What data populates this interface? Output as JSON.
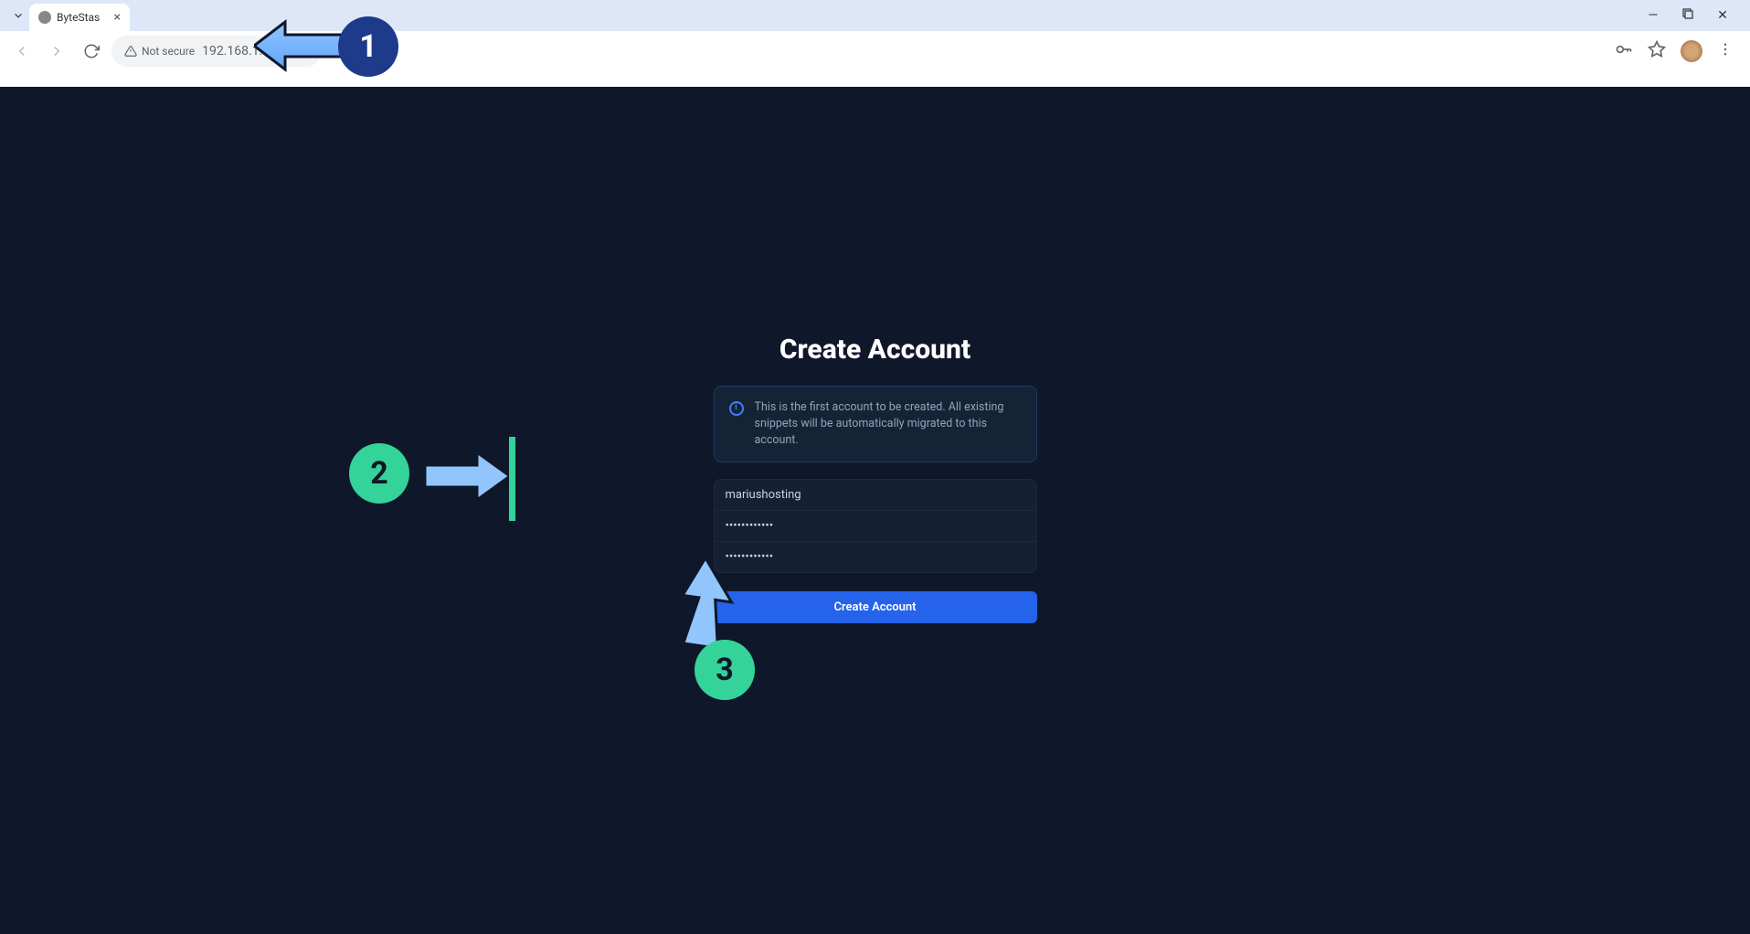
{
  "browser": {
    "tab_title": "ByteStas",
    "not_secure_label": "Not secure",
    "url": "192.168.1.18:7654"
  },
  "page": {
    "title": "Create Account",
    "info_text": "This is the first account to be created. All existing snippets will be automatically migrated to this account.",
    "username_value": "mariushosting",
    "password_value": "••••••••••••",
    "confirm_password_value": "••••••••••••",
    "button_label": "Create Account"
  },
  "annotations": {
    "step1": "1",
    "step2": "2",
    "step3": "3"
  }
}
